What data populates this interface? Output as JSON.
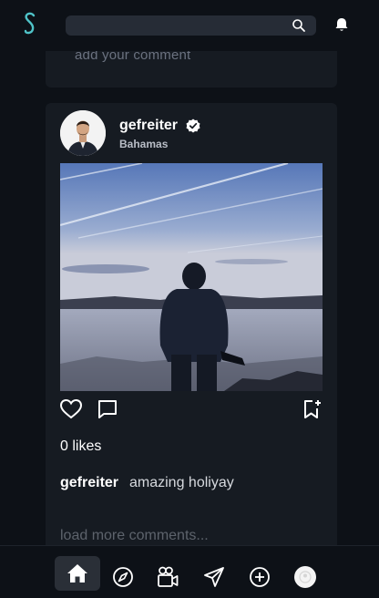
{
  "header": {
    "search_value": "",
    "search_placeholder": ""
  },
  "previous_post": {
    "comment_placeholder": "add your comment"
  },
  "post": {
    "username": "gefreiter",
    "location": "Bahamas",
    "likes": "0 likes",
    "caption_user": "gefreiter",
    "caption_text": "amazing holiyay",
    "load_more": "load more comments..."
  },
  "icons": {
    "logo": "s-logo",
    "search": "search-icon",
    "notifications": "bell-icon",
    "verified": "verified-badge-icon",
    "like": "heart-icon",
    "comment": "comment-icon",
    "save": "bookmark-add-icon",
    "nav": [
      "home-icon",
      "compass-icon",
      "video-camera-icon",
      "send-icon",
      "plus-circle-icon",
      "profile-avatar"
    ]
  },
  "colors": {
    "background": "#0d1117",
    "card": "#161b22",
    "accent": "#4fc3c8",
    "text": "#ffffff",
    "muted": "#6b7280"
  }
}
